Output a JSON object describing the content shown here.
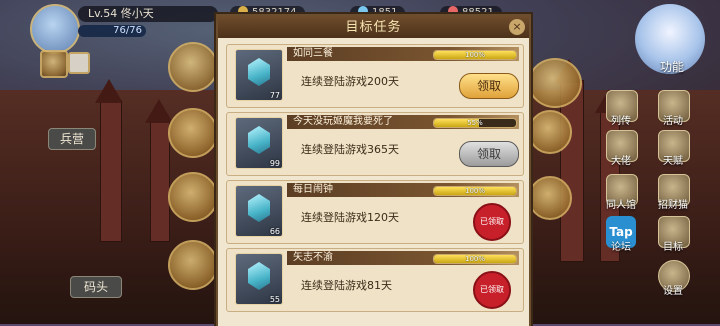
{
  "player": {
    "level_name": "Lv.54 佟小天",
    "energy": "76/76"
  },
  "resources": [
    "5832174",
    "1851",
    "88521"
  ],
  "left_menu": {
    "barracks": "兵营",
    "dock": "码头"
  },
  "right_menu": {
    "functions": "功能",
    "items": [
      {
        "label": "列传",
        "icon": "book-icon"
      },
      {
        "label": "活动",
        "icon": "star-badge-icon"
      },
      {
        "label": "大佬",
        "icon": "chess-king-icon"
      },
      {
        "label": "天赋",
        "icon": "talent-icon"
      },
      {
        "label": "同人馆",
        "icon": "castle-icon"
      },
      {
        "label": "招财猫",
        "icon": "lucky-cat-icon"
      },
      {
        "label": "论坛",
        "icon": "tap-icon"
      },
      {
        "label": "目标",
        "icon": "target-icon"
      },
      {
        "label": "设置",
        "icon": "gear-icon"
      }
    ],
    "tap_text": "Tap"
  },
  "modal": {
    "title": "目标任务",
    "close": "×",
    "tasks": [
      {
        "name": "如同三餐",
        "progress": 100,
        "progress_text": "100%",
        "desc": "连续登陆游戏200天",
        "count": "77",
        "status": "claim",
        "button": "领取"
      },
      {
        "name": "今天没玩姬魔我要死了",
        "progress": 55,
        "progress_text": "55%",
        "desc": "连续登陆游戏365天",
        "count": "99",
        "status": "disabled",
        "button": "领取"
      },
      {
        "name": "每日闹钟",
        "progress": 100,
        "progress_text": "100%",
        "desc": "连续登陆游戏120天",
        "count": "66",
        "status": "claimed",
        "stamp": "已领取"
      },
      {
        "name": "矢志不渝",
        "progress": 100,
        "progress_text": "100%",
        "desc": "连续登陆游戏81天",
        "count": "55",
        "status": "claimed",
        "stamp": "已领取"
      }
    ]
  },
  "colors": {
    "accent_gold": "#e0a23a",
    "stamp_red": "#c8202a",
    "panel": "#f1e6cf"
  }
}
